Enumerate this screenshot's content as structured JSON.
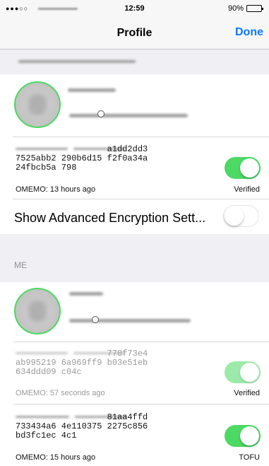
{
  "status_bar": {
    "signal": "●●●○○",
    "time": "12:59",
    "battery": "90%"
  },
  "nav": {
    "title": "Profile",
    "done_label": "Done"
  },
  "contact": {
    "fingerprint": "                  a1dd2dd3\n7525abb2 290b6d15 f2f0a34a\n24fbcb5a 798",
    "last_seen": "OMEMO: 13 hours ago",
    "trust_label": "Verified",
    "verified": true
  },
  "advanced": {
    "label": "Show Advanced Encryption Sett...",
    "enabled": false
  },
  "me_section": {
    "header": "ME"
  },
  "own_devices": [
    {
      "fingerprint": "                  770f73e4\nab995219 6a969ff9 b03e51eb\n634ddd09 c04c",
      "last_seen": "OMEMO: 57 seconds ago",
      "trust_label": "Verified",
      "verified": true
    },
    {
      "fingerprint": "                  81aa4ffd\n733434a6 4e110375 2275c856\nbd3fc1ec 4c1",
      "last_seen": "OMEMO: 15 hours ago",
      "trust_label": "TOFU",
      "verified": true
    }
  ],
  "colors": {
    "accent": "#0a7aff",
    "toggle_on": "#4cd964",
    "background": "#efeff4"
  }
}
